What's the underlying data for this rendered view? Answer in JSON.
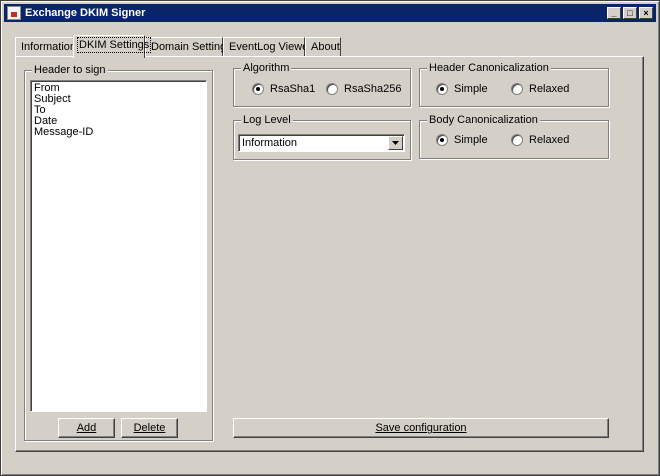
{
  "window": {
    "title": "Exchange DKIM Signer",
    "minimize_glyph": "_",
    "maximize_glyph": "□",
    "close_glyph": "×"
  },
  "tabs": [
    {
      "label": "Information"
    },
    {
      "label": "DKIM Settings"
    },
    {
      "label": "Domain Settings"
    },
    {
      "label": "EventLog Viewer"
    },
    {
      "label": "About"
    }
  ],
  "header_to_sign": {
    "label": "Header to sign",
    "items": [
      "From",
      "Subject",
      "To",
      "Date",
      "Message-ID"
    ],
    "add_label": "Add",
    "delete_label": "Delete"
  },
  "algorithm": {
    "label": "Algorithm",
    "options": [
      {
        "label": "RsaSha1",
        "checked": true
      },
      {
        "label": "RsaSha256",
        "checked": false
      }
    ]
  },
  "header_canonicalization": {
    "label": "Header Canonicalization",
    "options": [
      {
        "label": "Simple",
        "checked": true
      },
      {
        "label": "Relaxed",
        "checked": false
      }
    ]
  },
  "log_level": {
    "label": "Log Level",
    "value": "Information"
  },
  "body_canonicalization": {
    "label": "Body Canonicalization",
    "options": [
      {
        "label": "Simple",
        "checked": true
      },
      {
        "label": "Relaxed",
        "checked": false
      }
    ]
  },
  "save_label": "Save configuration"
}
